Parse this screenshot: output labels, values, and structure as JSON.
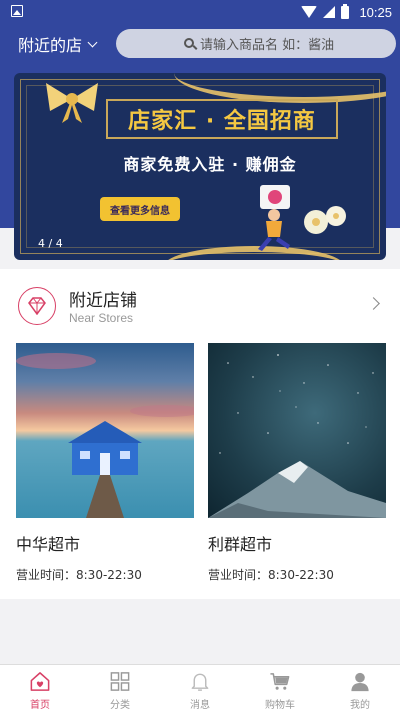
{
  "status_bar": {
    "time": "10:25"
  },
  "header": {
    "location_label": "附近的店",
    "search_placeholder": "请输入商品名 如：酱油"
  },
  "banner": {
    "title": "店家汇 · 全国招商",
    "subtitle": "商家免费入驻 · 赚佣金",
    "button_label": "查看更多信息",
    "page_indicator": "4 / 4"
  },
  "nearby_stores": {
    "title": "附近店铺",
    "subtitle": "Near Stores",
    "items": [
      {
        "name": "中华超市",
        "hours": "营业时间：8:30-22:30"
      },
      {
        "name": "利群超市",
        "hours": "营业时间：8:30-22:30"
      }
    ]
  },
  "tabbar": {
    "items": [
      {
        "label": "首页",
        "icon": "home-icon",
        "active": true
      },
      {
        "label": "分类",
        "icon": "grid-icon",
        "active": false
      },
      {
        "label": "消息",
        "icon": "bell-icon",
        "active": false
      },
      {
        "label": "购物车",
        "icon": "cart-icon",
        "active": false
      },
      {
        "label": "我的",
        "icon": "user-icon",
        "active": false
      }
    ]
  },
  "colors": {
    "header_blue": "#32479e",
    "accent": "#d84066"
  }
}
